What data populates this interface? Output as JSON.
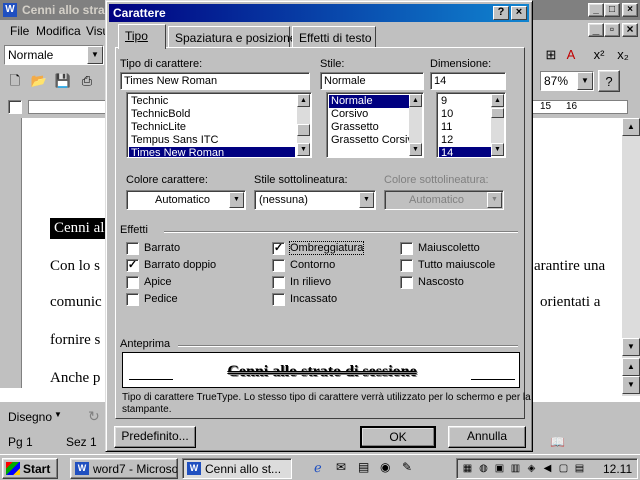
{
  "word": {
    "title": "Cenni allo strat",
    "menu": [
      "File",
      "Modifica",
      "Visu"
    ],
    "style_combo": "Normale",
    "zoom": "87%",
    "ruler_marks": [
      "15",
      "16"
    ],
    "doc_heading": "Cenni al",
    "doc_lines": [
      "Con lo s",
      "comunic",
      "fornire s",
      "Anche p"
    ],
    "doc_right_lines": [
      "arantire una",
      "orientati a"
    ],
    "draw_label": "Disegno",
    "status_page": "Pg 1",
    "status_section": "Sez 1"
  },
  "taskbar": {
    "start": "Start",
    "tasks": [
      "word7 - Microso...",
      "Cenni allo st..."
    ],
    "clock": "12.11"
  },
  "dialog": {
    "title": "Carattere",
    "tabs": [
      "Tipo",
      "Spaziatura e posizione",
      "Effetti di testo"
    ],
    "font_label": "Tipo di carattere:",
    "font_value": "Times New Roman",
    "font_list": [
      "Technic",
      "TechnicBold",
      "TechnicLite",
      "Tempus Sans ITC",
      "Times New Roman"
    ],
    "style_label": "Stile:",
    "style_value": "Normale",
    "style_list": [
      "Normale",
      "Corsivo",
      "Grassetto",
      "Grassetto Corsivo"
    ],
    "size_label": "Dimensione:",
    "size_value": "14",
    "size_list": [
      "9",
      "10",
      "11",
      "12",
      "14"
    ],
    "color_label": "Colore carattere:",
    "color_value": "Automatico",
    "underline_label": "Stile sottolineatura:",
    "underline_value": "(nessuna)",
    "underline_color_label": "Colore sottolineatura:",
    "underline_color_value": "Automatico",
    "effects_label": "Effetti",
    "effects": [
      {
        "label": "Barrato",
        "checked": false
      },
      {
        "label": "Barrato doppio",
        "checked": true
      },
      {
        "label": "Apice",
        "checked": false
      },
      {
        "label": "Pedice",
        "checked": false
      },
      {
        "label": "Ombreggiatura",
        "checked": true
      },
      {
        "label": "Contorno",
        "checked": false
      },
      {
        "label": "In rilievo",
        "checked": false
      },
      {
        "label": "Incassato",
        "checked": false
      },
      {
        "label": "Maiuscoletto",
        "checked": false
      },
      {
        "label": "Tutto maiuscole",
        "checked": false
      },
      {
        "label": "Nascosto",
        "checked": false
      }
    ],
    "preview_label": "Anteprima",
    "preview_text": "Cenni allo strato di sessione",
    "info_line1": "Tipo di carattere TrueType. Lo stesso tipo di carattere verrà utilizzato per lo schermo e per la",
    "info_line2": "stampante.",
    "btn_default": "Predefinito...",
    "btn_ok": "OK",
    "btn_cancel": "Annulla",
    "check_mark": "✓"
  }
}
